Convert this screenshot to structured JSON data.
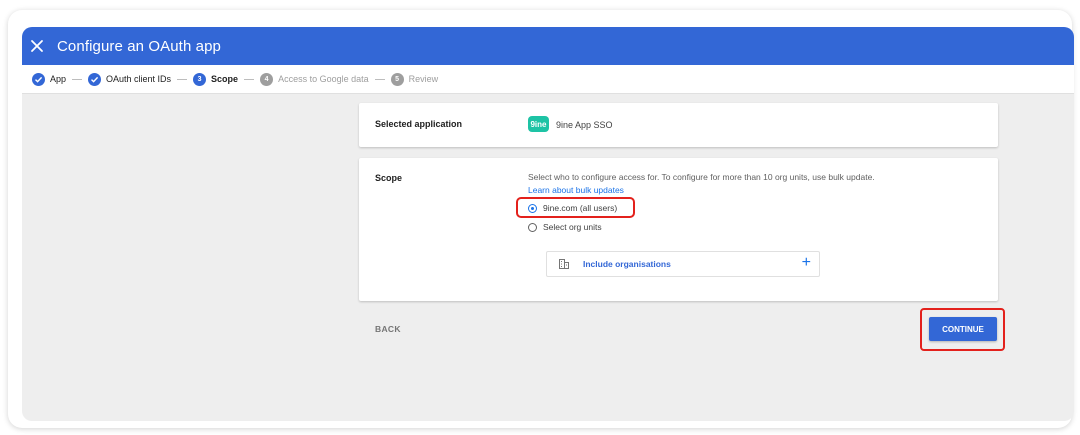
{
  "header": {
    "title": "Configure an OAuth app"
  },
  "stepper": {
    "steps": [
      {
        "number": "",
        "label": "App",
        "state": "done"
      },
      {
        "number": "",
        "label": "OAuth client IDs",
        "state": "done"
      },
      {
        "number": "3",
        "label": "Scope",
        "state": "active"
      },
      {
        "number": "4",
        "label": "Access to Google data",
        "state": "todo"
      },
      {
        "number": "5",
        "label": "Review",
        "state": "todo"
      }
    ]
  },
  "selected_app": {
    "label": "Selected application",
    "logo_text": "9ine",
    "name": "9ine App SSO"
  },
  "scope": {
    "label": "Scope",
    "description": "Select who to configure access for. To configure for more than 10 org units, use bulk update.",
    "link": "Learn about bulk updates",
    "options": [
      {
        "label": "9ine.com (all users)",
        "selected": true
      },
      {
        "label": "Select org units",
        "selected": false
      }
    ],
    "include_label": "Include organisations"
  },
  "footer": {
    "back_label": "BACK",
    "continue_label": "CONTINUE"
  },
  "colors": {
    "primary": "#3367d6",
    "highlight": "#e3211c",
    "logo": "#1ec3a5"
  }
}
